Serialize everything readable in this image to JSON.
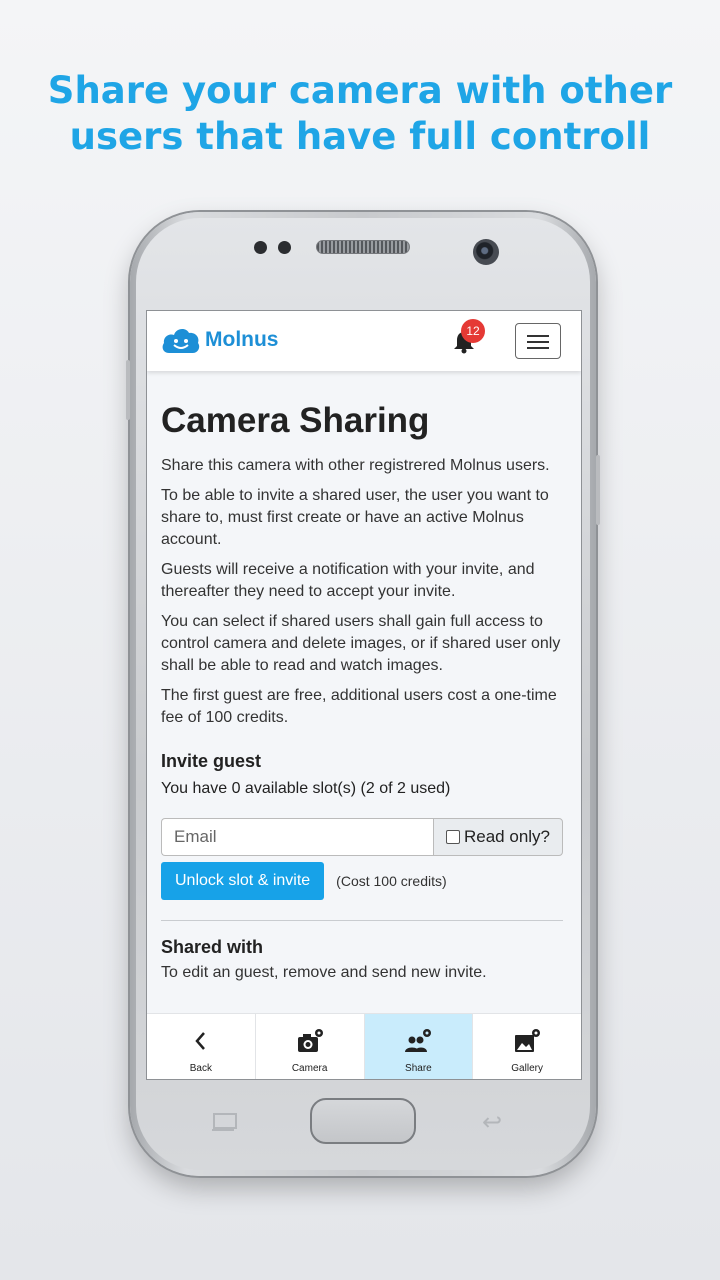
{
  "headline": {
    "line1": "Share your camera with other",
    "line2": "users that have full controll"
  },
  "colors": {
    "accent": "#1fa5e6",
    "button": "#17a2e8",
    "badge": "#e53935",
    "active_tab": "#c9ecfc"
  },
  "appbar": {
    "logo_text": "Molnus",
    "notification_count": "12",
    "icons": {
      "logo": "cloud-smiley-logo",
      "notifications": "bell-icon",
      "menu": "hamburger-icon"
    }
  },
  "page": {
    "title": "Camera Sharing",
    "paragraphs": [
      "Share this camera with other registrered Molnus users.",
      "To be able to invite a shared user, the user you want to share to, must first create or have an active Molnus account.",
      "Guests will receive a notification with your invite, and thereafter they need to accept your invite.",
      "You can select if shared users shall gain full access to control camera and delete images, or if shared user only shall be able to read and watch images.",
      "The first guest are free, additional users cost a one-time fee of 100 credits."
    ],
    "invite": {
      "title": "Invite guest",
      "slots": "You have 0 available slot(s) (2 of 2 used)",
      "email_placeholder": "Email",
      "email_value": "",
      "readonly_label": "Read only?",
      "readonly_checked": false,
      "unlock_button": "Unlock slot & invite",
      "cost": "(Cost 100 credits)"
    },
    "shared": {
      "title": "Shared with",
      "text": "To edit an guest, remove and send new invite."
    }
  },
  "bottom_nav": [
    {
      "label": "Back",
      "icon": "chevron-left-icon",
      "active": false
    },
    {
      "label": "Camera",
      "icon": "camera-settings-icon",
      "active": false
    },
    {
      "label": "Share",
      "icon": "people-settings-icon",
      "active": true
    },
    {
      "label": "Gallery",
      "icon": "image-settings-icon",
      "active": false
    }
  ]
}
